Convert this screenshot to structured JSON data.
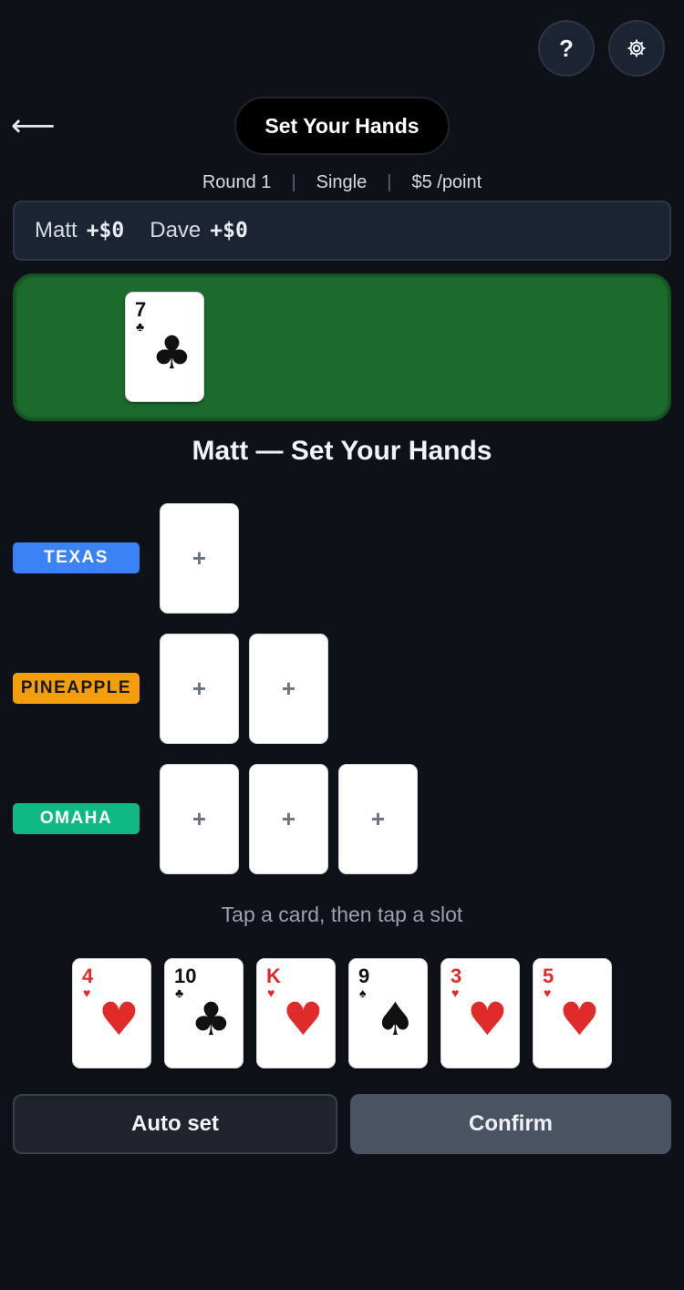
{
  "header": {
    "help_label": "?",
    "settings_icon": "gear-icon",
    "back_icon": "arrow-left-icon",
    "back_glyph": "⟵",
    "title": "Set Your Hands"
  },
  "meta": {
    "round": "Round 1",
    "mode": "Single",
    "stake": "$5 /point",
    "separator": "|"
  },
  "scores": [
    {
      "name": "Matt",
      "value": "+$0"
    },
    {
      "name": "Dave",
      "value": "+$0"
    }
  ],
  "board": {
    "cards": [
      {
        "rank": "7",
        "suit": "♣",
        "color": "black"
      }
    ]
  },
  "player_heading": "Matt — Set Your Hands",
  "hands": [
    {
      "label": "TEXAS",
      "color": "#3b82f6",
      "text_color": "#ffffff",
      "slots": 1
    },
    {
      "label": "PINEAPPLE",
      "color": "#f59e0b",
      "text_color": "#1a1a1a",
      "slots": 2
    },
    {
      "label": "OMAHA",
      "color": "#10b981",
      "text_color": "#ffffff",
      "slots": 3
    }
  ],
  "slot_glyph": "+",
  "hint": "Tap a card, then tap a slot",
  "player_cards": [
    {
      "rank": "4",
      "suit": "♥",
      "color": "red"
    },
    {
      "rank": "10",
      "suit": "♣",
      "color": "black"
    },
    {
      "rank": "K",
      "suit": "♥",
      "color": "red"
    },
    {
      "rank": "9",
      "suit": "♠",
      "color": "black"
    },
    {
      "rank": "3",
      "suit": "♥",
      "color": "red"
    },
    {
      "rank": "5",
      "suit": "♥",
      "color": "red"
    }
  ],
  "buttons": {
    "auto_set": "Auto set",
    "confirm": "Confirm"
  },
  "colors": {
    "background": "#0e1117",
    "felt": "#1d6b2c",
    "panel": "#1c2433",
    "confirm_bg": "#4a5362",
    "auto_bg": "#1f242c"
  }
}
